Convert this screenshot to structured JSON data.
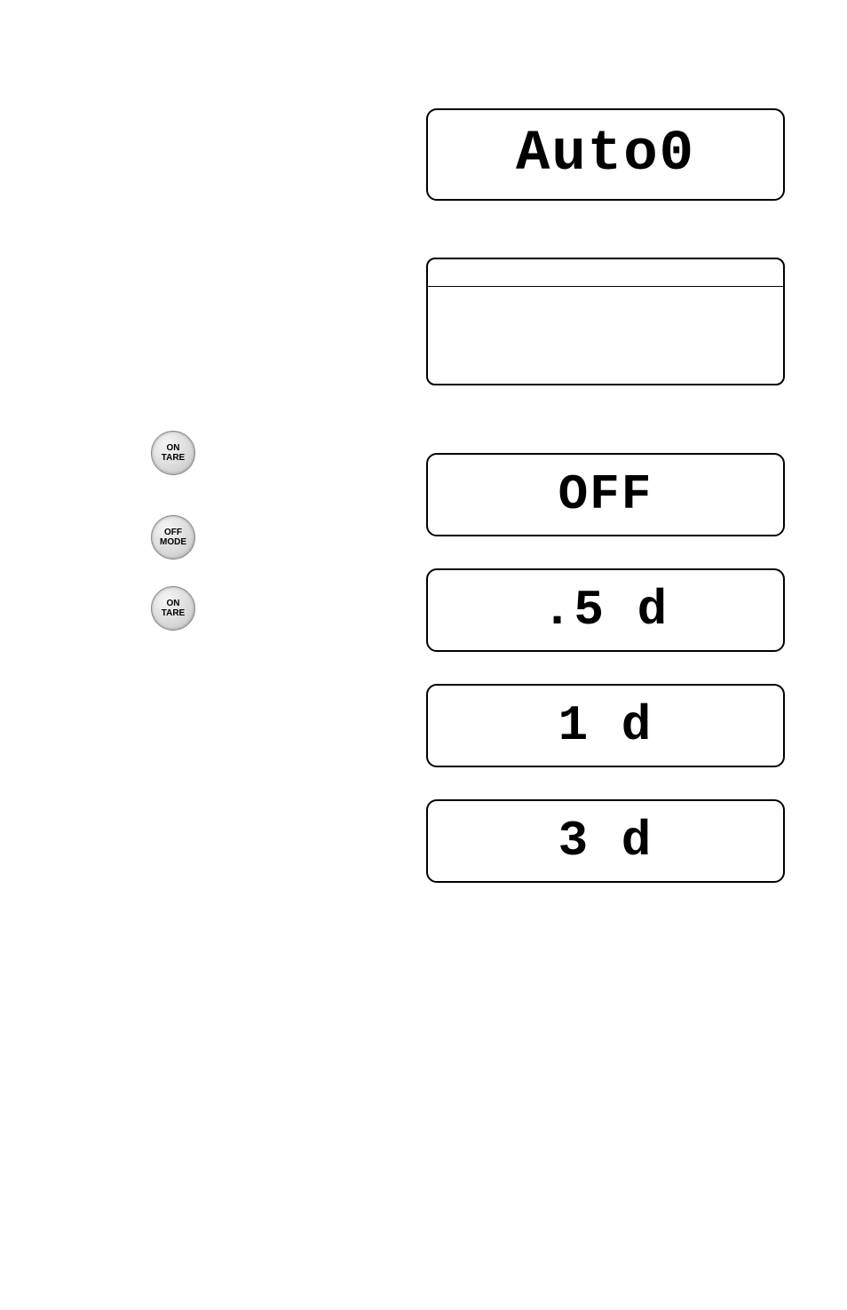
{
  "displays": {
    "auto0": "Auto0",
    "off": "OFF",
    "p5d": ".5  d",
    "d1": "1  d",
    "d3": "3  d"
  },
  "buttons": {
    "on_tare_1": {
      "line1": "ON",
      "line2": "TARE"
    },
    "off_mode": {
      "line1": "OFF",
      "line2": "MODE"
    },
    "on_tare_2": {
      "line1": "ON",
      "line2": "TARE"
    }
  }
}
